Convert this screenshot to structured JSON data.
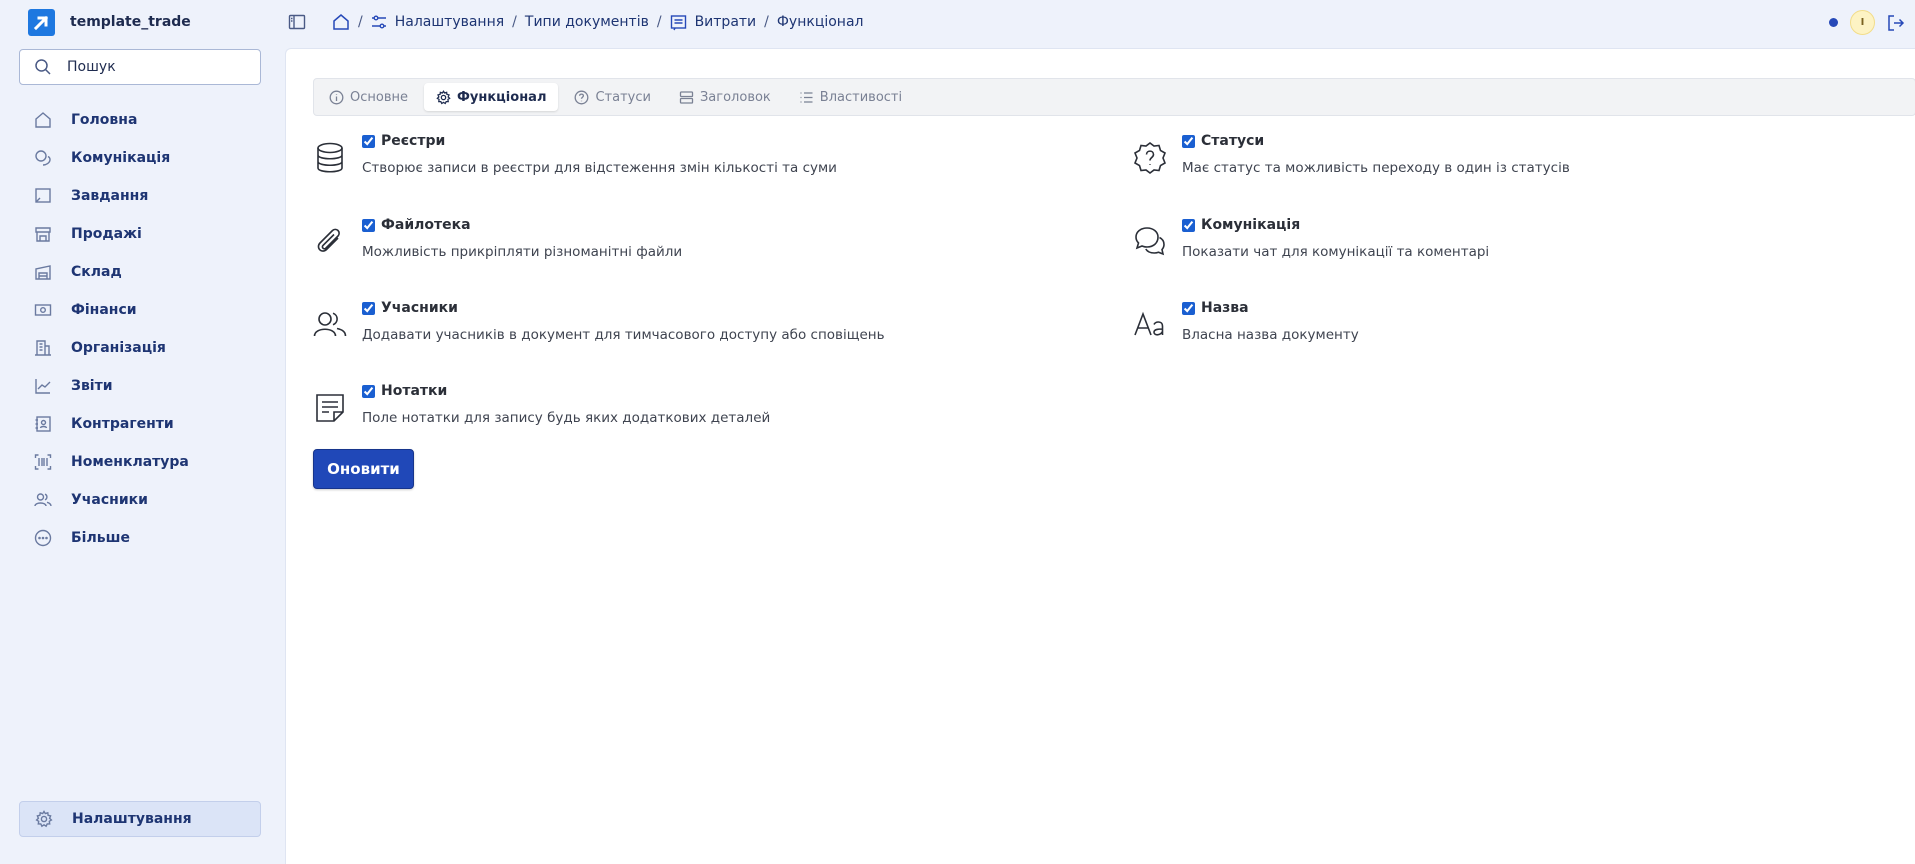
{
  "brand": {
    "name": "template_trade"
  },
  "search": {
    "placeholder": "Пошук"
  },
  "sidebar": {
    "items": [
      {
        "label": "Головна",
        "icon": "home-icon"
      },
      {
        "label": "Комунікація",
        "icon": "chat-icon"
      },
      {
        "label": "Завдання",
        "icon": "task-icon"
      },
      {
        "label": "Продажі",
        "icon": "store-icon"
      },
      {
        "label": "Склад",
        "icon": "warehouse-icon"
      },
      {
        "label": "Фінанси",
        "icon": "banknote-icon"
      },
      {
        "label": "Організація",
        "icon": "building-icon"
      },
      {
        "label": "Звіти",
        "icon": "chart-line-icon"
      },
      {
        "label": "Контрагенти",
        "icon": "contact-book-icon"
      },
      {
        "label": "Номенклатура",
        "icon": "barcode-icon"
      },
      {
        "label": "Учасники",
        "icon": "users-icon"
      },
      {
        "label": "Більше",
        "icon": "more-icon"
      }
    ],
    "settings_label": "Налаштування"
  },
  "breadcrumb": {
    "items": [
      "Налаштування",
      "Типи документів",
      "Витрати",
      "Функціонал"
    ],
    "separator": "/"
  },
  "user": {
    "avatar_initial": "І",
    "status_color": "#2649b8"
  },
  "tabs": [
    {
      "label": "Основне",
      "icon": "info-icon",
      "active": false
    },
    {
      "label": "Функціонал",
      "icon": "gear-icon",
      "active": true
    },
    {
      "label": "Статуси",
      "icon": "question-circle-icon",
      "active": false
    },
    {
      "label": "Заголовок",
      "icon": "layout-header-icon",
      "active": false
    },
    {
      "label": "Властивості",
      "icon": "list-icon",
      "active": false
    }
  ],
  "features": {
    "registers": {
      "title": "Реєстри",
      "desc": "Створює записи в реєстри для відстеження змін кількості та суми",
      "checked": true
    },
    "statuses": {
      "title": "Статуси",
      "desc": "Має статус та можливість переходу в один із статусів",
      "checked": true
    },
    "files": {
      "title": "Файлотека",
      "desc": "Можливість прикріпляти різноманітні файли",
      "checked": true
    },
    "communication": {
      "title": "Комунікація",
      "desc": "Показати чат для комунікації та коментарі",
      "checked": true
    },
    "participants": {
      "title": "Учасники",
      "desc": "Додавати учасників в документ для тимчасового доступу або сповіщень",
      "checked": true
    },
    "name": {
      "title": "Назва",
      "desc": "Власна назва документу",
      "checked": true
    },
    "notes": {
      "title": "Нотатки",
      "desc": "Поле нотатки для запису будь яких додаткових деталей",
      "checked": true
    }
  },
  "actions": {
    "update_label": "Оновити"
  },
  "colors": {
    "accent": "#2048b8",
    "sidebar_bg": "#eef2fb",
    "brand": "#1e78e0"
  }
}
